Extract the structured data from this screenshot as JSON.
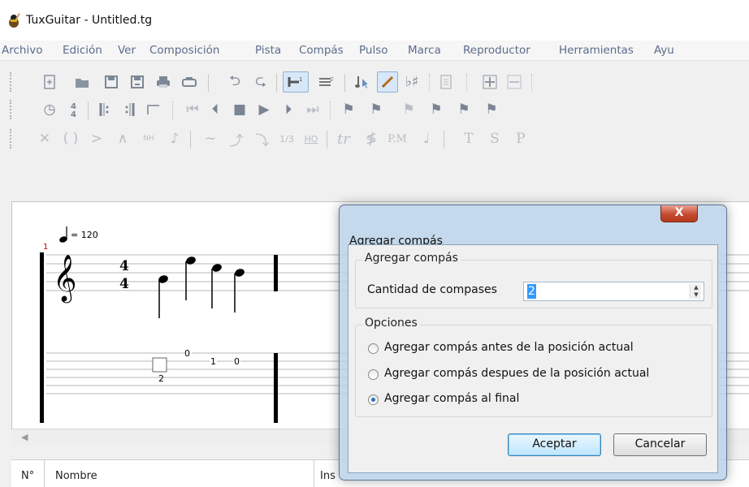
{
  "window": {
    "title": "TuxGuitar - Untitled.tg"
  },
  "menu": [
    "Archivo",
    "Edición",
    "Ver",
    "Composición",
    "Pista",
    "Compás",
    "Pulso",
    "Marca",
    "Reproductor",
    "Herramientas",
    "Ayu"
  ],
  "toolbar": {
    "row3_labels": {
      "grace": "1/3",
      "hammer": "HO",
      "trill": "tr",
      "palm_mute": "P.M",
      "tapping": "T",
      "slapping": "S",
      "popping": "P",
      "natural_harmonic": "NH"
    }
  },
  "score": {
    "tempo": "= 120",
    "measure_number": "1",
    "time_signature": {
      "top": "4",
      "bottom": "4"
    },
    "tab_numbers": [
      "2",
      "0",
      "1",
      "0"
    ]
  },
  "track_table": {
    "columns": [
      "N°",
      "Nombre",
      "Ins"
    ]
  },
  "dialog": {
    "title": "Agregar compás",
    "close_label": "X",
    "group1": {
      "legend": "Agregar compás",
      "field_label": "Cantidad de compases",
      "value": "2"
    },
    "group2": {
      "legend": "Opciones",
      "options": [
        {
          "label": "Agregar compás antes de la posición actual",
          "selected": false
        },
        {
          "label": "Agregar compás despues de la posición actual",
          "selected": false
        },
        {
          "label": "Agregar compás al final",
          "selected": true
        }
      ]
    },
    "accept_label": "Aceptar",
    "cancel_label": "Cancelar"
  }
}
